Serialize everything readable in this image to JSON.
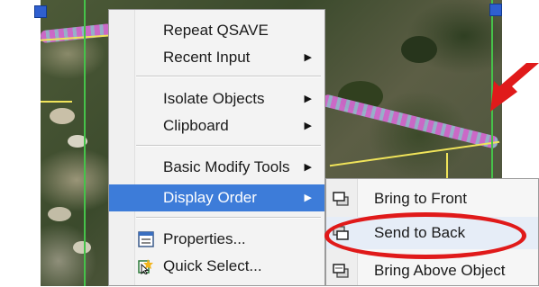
{
  "context_menu": {
    "items": [
      {
        "label": "Repeat QSAVE",
        "submenu": false
      },
      {
        "label": "Recent Input",
        "submenu": true
      },
      {
        "label": "Isolate Objects",
        "submenu": true
      },
      {
        "label": "Clipboard",
        "submenu": true
      },
      {
        "label": "Basic Modify Tools",
        "submenu": true
      },
      {
        "label": "Display Order",
        "submenu": true,
        "highlighted": true
      },
      {
        "label": "Properties...",
        "submenu": false,
        "icon": "properties-icon"
      },
      {
        "label": "Quick Select...",
        "submenu": false,
        "icon": "quick-select-icon"
      }
    ],
    "submenu_arrow": "▶"
  },
  "display_order_submenu": {
    "items": [
      {
        "label": "Bring to Front",
        "icon": "bring-to-front-icon"
      },
      {
        "label": "Send to Back",
        "icon": "send-to-back-icon",
        "annotated": true
      },
      {
        "label": "Bring Above Object",
        "icon": "bring-above-object-icon"
      }
    ]
  },
  "annotation": {
    "color": "#e01a1a",
    "ellipse_target": "Send to Back",
    "arrow": "red-arrow"
  },
  "colors": {
    "menu_highlight": "#3d7cd9",
    "grip": "#2f5fd0",
    "polyline": "#f0e45a",
    "road_hatch": "#d86bd6"
  }
}
